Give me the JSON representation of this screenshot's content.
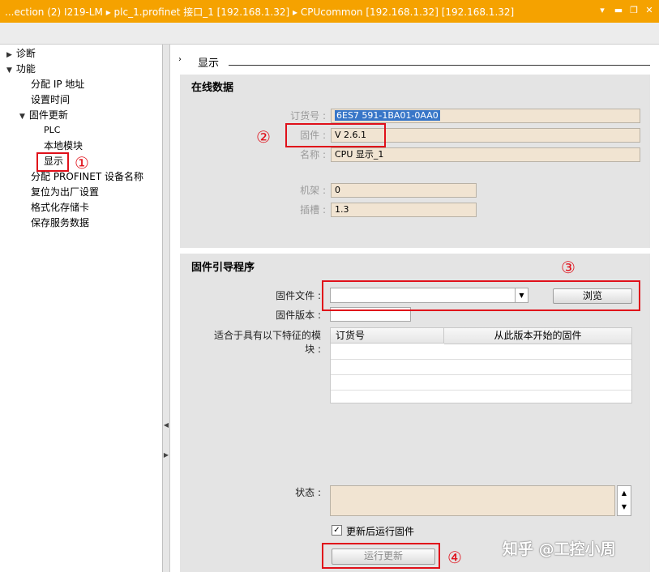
{
  "window": {
    "breadcrumb": [
      "...ection (2) I219-LM",
      "plc_1.profinet 接口_1 [192.168.1.32]",
      "CPUcommon [192.168.1.32] [192.168.1.32]"
    ],
    "controls": [
      "▾",
      "▬",
      "❐",
      "✕"
    ]
  },
  "tree": {
    "items": [
      {
        "label": "诊断",
        "expanded": false
      },
      {
        "label": "功能",
        "expanded": true
      },
      {
        "label": "分配 IP 地址"
      },
      {
        "label": "设置时间"
      },
      {
        "label": "固件更新",
        "expanded": true
      },
      {
        "label": "PLC"
      },
      {
        "label": "本地模块"
      },
      {
        "label": "显示",
        "selected": true
      },
      {
        "label": "分配 PROFINET 设备名称"
      },
      {
        "label": "复位为出厂设置"
      },
      {
        "label": "格式化存储卡"
      },
      {
        "label": "保存服务数据"
      }
    ]
  },
  "section": {
    "title": "显示"
  },
  "online_data": {
    "title": "在线数据",
    "order_no_label": "订货号 :",
    "order_no_value": "6ES7 591-1BA01-0AA0",
    "firmware_label": "固件 :",
    "firmware_value": "V 2.6.1",
    "name_label": "名称 :",
    "name_value": "CPU 显示_1",
    "rack_label": "机架 :",
    "rack_value": "0",
    "slot_label": "插槽 :",
    "slot_value": "1.3"
  },
  "loader": {
    "title": "固件引导程序",
    "fw_file_label": "固件文件 :",
    "fw_file_value": "",
    "browse_label": "浏览",
    "fw_version_label": "固件版本 :",
    "fw_version_value": "",
    "suitable_label_1": "适合于具有以下特征的模",
    "suitable_label_2": "块 :",
    "table_headers": [
      "订货号",
      "从此版本开始的固件"
    ],
    "status_label": "状态 :",
    "status_value": "",
    "run_after_update_label": "更新后运行固件",
    "run_after_update_checked": true,
    "run_update_label": "运行更新"
  },
  "annotations": [
    "①",
    "②",
    "③",
    "④"
  ],
  "watermark": "知乎 @工控小周",
  "colors": {
    "titlebar": "#f5a200",
    "annotation_red": "#e0101a",
    "field_bg": "#f1e4d2",
    "selection": "#3876c8"
  }
}
